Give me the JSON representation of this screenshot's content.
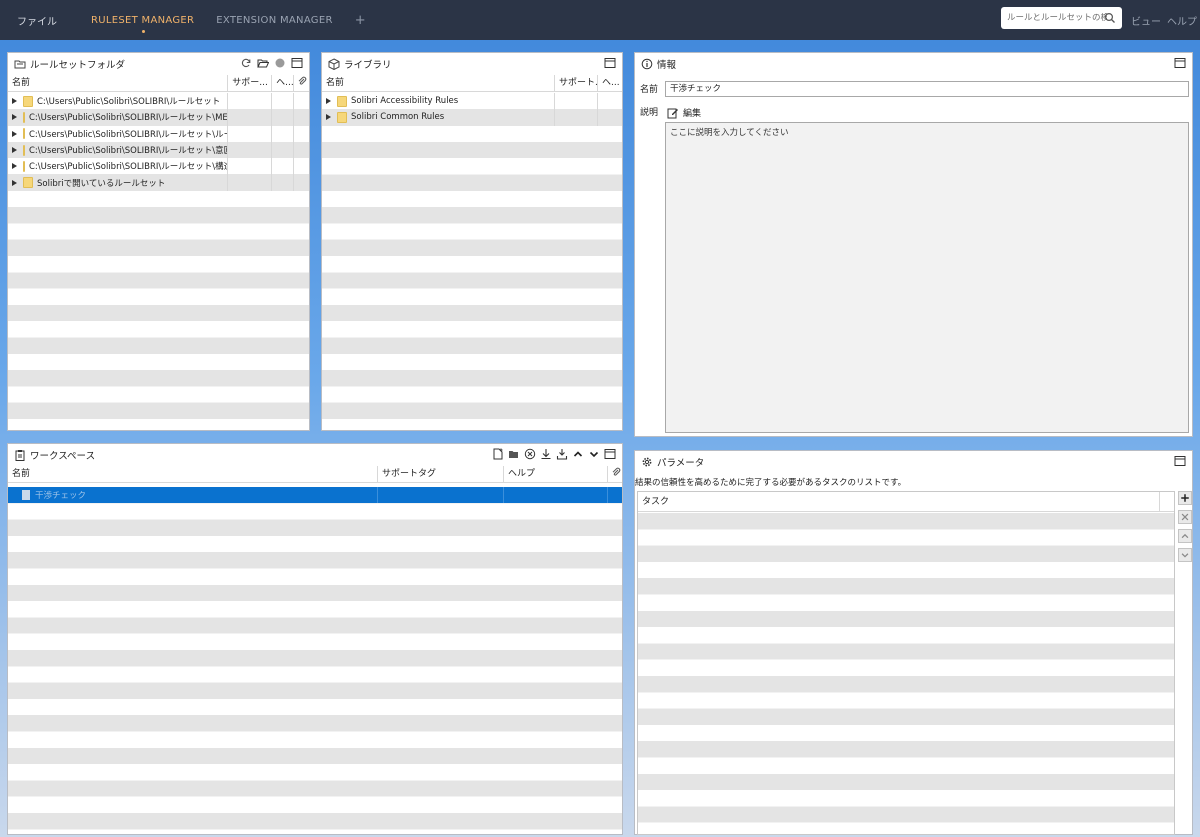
{
  "topbar": {
    "file_menu": "ファイル",
    "tabs": [
      "RULESET MANAGER",
      "EXTENSION MANAGER"
    ],
    "add_tab": "+",
    "search_placeholder": "ルールとルールセットの検索",
    "view_menu": "ビュー",
    "help_menu": "ヘルプ"
  },
  "ruleset_panel": {
    "title": "ルールセットフォルダ",
    "columns": [
      "名前",
      "サポー...",
      "ヘ..."
    ],
    "rows": [
      "C:\\Users\\Public\\Solibri\\SOLIBRI\\ルールセット",
      "C:\\Users\\Public\\Solibri\\SOLIBRI\\ルールセット\\MEP",
      "C:\\Users\\Public\\Solibri\\SOLIBRI\\ルールセット\\ルール",
      "C:\\Users\\Public\\Solibri\\SOLIBRI\\ルールセット\\意匠",
      "C:\\Users\\Public\\Solibri\\SOLIBRI\\ルールセット\\構造",
      "Solibriで開いているルールセット"
    ]
  },
  "library_panel": {
    "title": "ライブラリ",
    "columns": [
      "名前",
      "サポート...",
      "ヘ..."
    ],
    "rows": [
      "Solibri Accessibility Rules",
      "Solibri Common Rules"
    ]
  },
  "info_panel": {
    "title": "情報",
    "name_label": "名前",
    "name_value": "干渉チェック",
    "desc_label": "説明",
    "edit_label": "編集",
    "desc_placeholder": "ここに説明を入力してください"
  },
  "workspace_panel": {
    "title": "ワークスペース",
    "columns": [
      "名前",
      "サポートタグ",
      "ヘルプ"
    ],
    "rows": [
      "干渉チェック"
    ]
  },
  "params_panel": {
    "title": "パラメータ",
    "description": "結果の信頼性を高めるために完了する必要があるタスクのリストです。",
    "columns": [
      "タスク"
    ]
  },
  "colors": {
    "topbar_bg": "#2b3446",
    "active_tab": "#f0b26a",
    "selection": "#0a72cf"
  }
}
